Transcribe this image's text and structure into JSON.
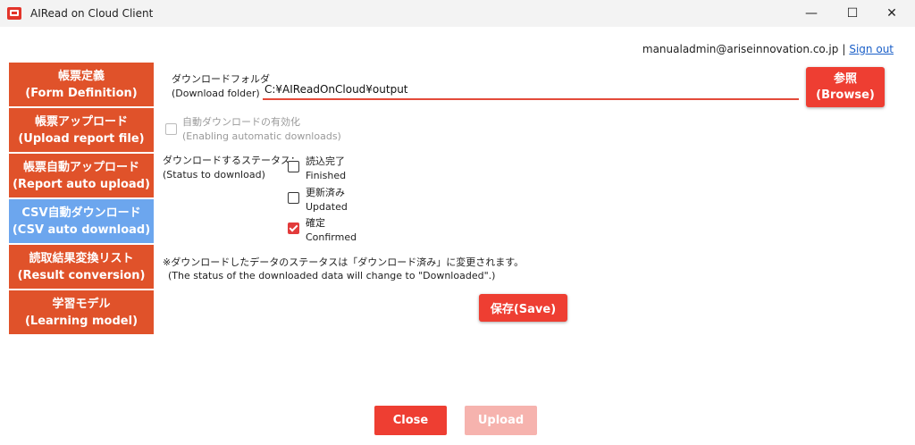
{
  "window": {
    "title": "AIRead on Cloud Client",
    "minimize": "—",
    "maximize": "☐",
    "close": "✕"
  },
  "user": {
    "email": "manualadmin@ariseinnovation.co.jp",
    "separator": "|",
    "signout": "Sign out"
  },
  "sidebar": {
    "items": [
      {
        "ja": "帳票定義",
        "en": "(Form Definition)"
      },
      {
        "ja": "帳票アップロード",
        "en": "(Upload report file)"
      },
      {
        "ja": "帳票自動アップロード",
        "en": "(Report auto upload)"
      },
      {
        "ja": "CSV自動ダウンロード",
        "en": "(CSV auto download)"
      },
      {
        "ja": "読取結果変換リスト",
        "en": "(Result conversion)"
      },
      {
        "ja": "学習モデル",
        "en": "(Learning model)"
      }
    ]
  },
  "folder": {
    "label_ja": "ダウンロードフォルダ",
    "label_en": "(Download folder)",
    "value": "C:¥AIReadOnCloud¥output"
  },
  "browse": {
    "ja": "参照",
    "en": "(Browse)"
  },
  "auto": {
    "label_ja": "自動ダウンロードの有効化",
    "label_en": "(Enabling automatic downloads)"
  },
  "status": {
    "label_ja": "ダウンロードするステータス：",
    "label_en": "(Status to download)",
    "options": [
      {
        "ja": "読込完了",
        "en": "Finished"
      },
      {
        "ja": "更新済み",
        "en": "Updated"
      },
      {
        "ja": "確定",
        "en": "Confirmed"
      }
    ]
  },
  "note": {
    "ja": "※ダウンロードしたデータのステータスは「ダウンロード済み」に変更されます。",
    "en": "(The status of the downloaded data will change to \"Downloaded\".)"
  },
  "buttons": {
    "save": "保存(Save)",
    "close": "Close",
    "upload": "Upload"
  },
  "colors": {
    "accent": "#ee3e32",
    "nav": "#e0522a",
    "nav_active": "#6ca6ee"
  }
}
